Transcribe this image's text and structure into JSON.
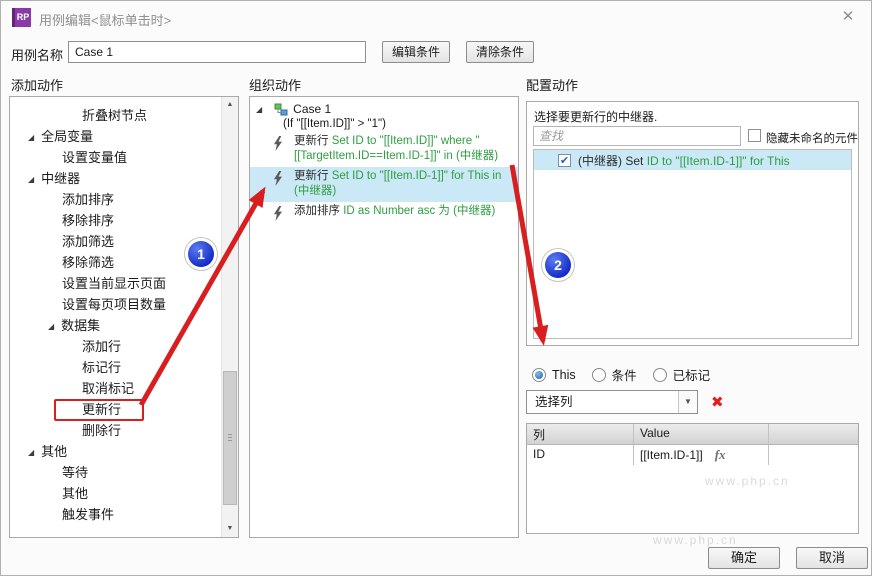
{
  "window": {
    "title": "用例编辑<鼠标单击时>",
    "app_icon": "RP",
    "close_icon": "✕"
  },
  "form": {
    "name_label": "用例名称",
    "name_value": "Case 1",
    "edit_condition_label": "编辑条件",
    "clear_condition_label": "清除条件"
  },
  "panel_headers": {
    "add_actions": "添加动作",
    "organize_actions": "组织动作",
    "configure_actions": "配置动作"
  },
  "action_tree": {
    "items": [
      {
        "label": "折叠树节点",
        "level": 3,
        "expanded": false,
        "highlighted": false
      },
      {
        "label": "全局变量",
        "level": 1,
        "expanded": true,
        "highlighted": false
      },
      {
        "label": "设置变量值",
        "level": 2,
        "expanded": false,
        "highlighted": false
      },
      {
        "label": "中继器",
        "level": 1,
        "expanded": true,
        "highlighted": false
      },
      {
        "label": "添加排序",
        "level": 2,
        "expanded": false,
        "highlighted": false
      },
      {
        "label": "移除排序",
        "level": 2,
        "expanded": false,
        "highlighted": false
      },
      {
        "label": "添加筛选",
        "level": 2,
        "expanded": false,
        "highlighted": false
      },
      {
        "label": "移除筛选",
        "level": 2,
        "expanded": false,
        "highlighted": false
      },
      {
        "label": "设置当前显示页面",
        "level": 2,
        "expanded": false,
        "highlighted": false
      },
      {
        "label": "设置每页项目数量",
        "level": 2,
        "expanded": false,
        "highlighted": false
      },
      {
        "label": "数据集",
        "level": 2,
        "expanded": true,
        "highlighted": false
      },
      {
        "label": "添加行",
        "level": 3,
        "expanded": false,
        "highlighted": false
      },
      {
        "label": "标记行",
        "level": 3,
        "expanded": false,
        "highlighted": false
      },
      {
        "label": "取消标记",
        "level": 3,
        "expanded": false,
        "highlighted": false
      },
      {
        "label": "更新行",
        "level": 3,
        "expanded": false,
        "highlighted": true
      },
      {
        "label": "删除行",
        "level": 3,
        "expanded": false,
        "highlighted": false
      },
      {
        "label": "其他",
        "level": 1,
        "expanded": true,
        "highlighted": false
      },
      {
        "label": "等待",
        "level": 2,
        "expanded": false,
        "highlighted": false
      },
      {
        "label": "其他",
        "level": 2,
        "expanded": false,
        "highlighted": false
      },
      {
        "label": "触发事件",
        "level": 2,
        "expanded": false,
        "highlighted": false
      }
    ]
  },
  "case_tree": {
    "case_label": "Case 1",
    "condition": "(If \"[[Item.ID]]\" > \"1\")",
    "actions": [
      {
        "name": "更新行",
        "desc": "Set ID to \"[[Item.ID]]\" where \"[[TargetItem.ID==Item.ID-1]]\" in (中继器)",
        "selected": false
      },
      {
        "name": "更新行",
        "desc": "Set ID to \"[[Item.ID-1]]\" for This in (中继器)",
        "selected": true
      },
      {
        "name": "添加排序",
        "desc": "ID as Number asc 为 (中继器)",
        "selected": false
      }
    ]
  },
  "configure": {
    "instruction": "选择要更新行的中继器.",
    "search_placeholder": "查找",
    "hide_unnamed_label": "隐藏未命名的元件",
    "repeater_item": {
      "checked": true,
      "check_glyph": "✔",
      "name": "(中继器) Set",
      "desc": "ID to \"[[Item.ID-1]]\" for This"
    },
    "radios": [
      {
        "label": "This",
        "selected": true
      },
      {
        "label": "条件",
        "selected": false
      },
      {
        "label": "已标记",
        "selected": false
      }
    ],
    "column_select_value": "选择列",
    "remove_icon": "✖",
    "table": {
      "headers": [
        "列",
        "Value",
        ""
      ],
      "rows": [
        {
          "column": "ID",
          "value": "[[Item.ID-1]]",
          "fx": "fx"
        }
      ]
    }
  },
  "footer": {
    "ok_label": "确定",
    "cancel_label": "取消"
  },
  "annotations": {
    "badge1": "1",
    "badge2": "2"
  },
  "watermark": "www.php.cn",
  "colors": {
    "accent_green": "#2e9e40",
    "selection_blue": "#cbe8f6",
    "annotation_red": "#d81e1e",
    "badge_blue": "#1228c8",
    "logo_purple": "#8a3aa8"
  }
}
